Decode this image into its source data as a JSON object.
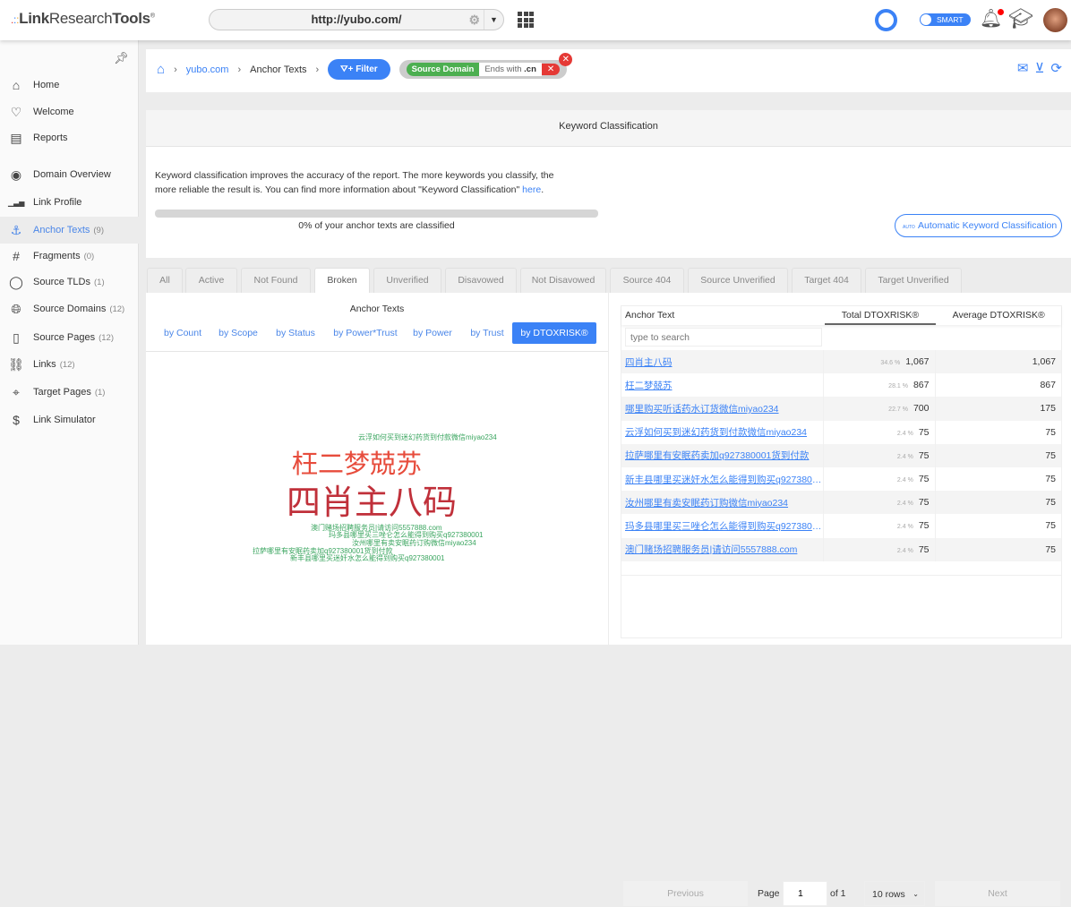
{
  "header": {
    "logo_prefix": "Link",
    "logo_mid": "Research",
    "logo_suffix": "Tools",
    "logo_mark": "®",
    "url": "http://yubo.com/",
    "smart_label": "SMART",
    "icons": [
      "gear-icon",
      "apps-grid-icon",
      "progress-ring-icon",
      "bell-icon",
      "graduation-cap-icon",
      "avatar"
    ]
  },
  "sidebar": {
    "items": [
      {
        "label": "Home",
        "count": "",
        "icon": "home-icon"
      },
      {
        "label": "Welcome",
        "count": "",
        "icon": "heart-icon"
      },
      {
        "label": "Reports",
        "count": "",
        "icon": "reports-icon"
      },
      {
        "label": "Domain Overview",
        "count": "",
        "icon": "eye-icon"
      },
      {
        "label": "Link Profile",
        "count": "",
        "icon": "bar-chart-icon"
      },
      {
        "label": "Anchor Texts",
        "count": "(9)",
        "icon": "anchor-icon",
        "active": true
      },
      {
        "label": "Fragments",
        "count": "(0)",
        "icon": "hash-icon"
      },
      {
        "label": "Source TLDs",
        "count": "(1)",
        "icon": "com-icon"
      },
      {
        "label": "Source Domains",
        "count": "(12)",
        "icon": "globe-icon"
      },
      {
        "label": "Source Pages",
        "count": "(12)",
        "icon": "url-file-icon"
      },
      {
        "label": "Links",
        "count": "(12)",
        "icon": "link-icon"
      },
      {
        "label": "Target Pages",
        "count": "(1)",
        "icon": "crosshair-icon"
      },
      {
        "label": "Link Simulator",
        "count": "",
        "icon": "dollar-icon"
      }
    ]
  },
  "breadcrumb": {
    "domain": "yubo.com",
    "page": "Anchor Texts",
    "filter_label": "Filter",
    "filter_chip": {
      "field": "Source Domain",
      "op": "Ends with",
      "value": ".cn"
    }
  },
  "classification": {
    "title": "Keyword Classification",
    "text": "Keyword classification improves the accuracy of the report. The more keywords you classify, the more reliable the result is. You can find more information about \"Keyword Classification\" ",
    "link": "here",
    "text_end": ".",
    "progress": 0,
    "progress_label": "0% of your anchor texts are classified",
    "auto_button": "Automatic Keyword Classification",
    "auto_badge": "AUTO"
  },
  "tabs": [
    "All",
    "Active",
    "Not Found",
    "Broken",
    "Unverified",
    "Disavowed",
    "Not Disavowed",
    "Source 404",
    "Source Unverified",
    "Target 404",
    "Target Unverified"
  ],
  "active_tab": "Broken",
  "cloud": {
    "title": "Anchor Texts",
    "sorts": [
      "by Count",
      "by Scope",
      "by Status",
      "by Power*Trust",
      "by Power",
      "by Trust",
      "by DTOXRISK®"
    ],
    "active_sort": "by DTOXRISK®",
    "words": [
      "云浮如何买到迷幻药货到付款微信miyao234",
      "枉二梦兢苏",
      "四肖主八码",
      "澳门赌场招聘服务员|请访问5557888.com",
      "玛多县哪里买三唑仑怎么能得到购买q927380001",
      "汝州哪里有卖安眠药订购微信miyao234",
      "拉萨哪里有安眠药卖加q927380001货到付款",
      "新丰县哪里买迷奸水怎么能得到购买q927380001"
    ],
    "colors": {
      "red": "#e74c3c",
      "darkred": "#c0303a",
      "green": "#3aa55f"
    }
  },
  "table": {
    "columns": [
      "Anchor Text",
      "Total DTOXRISK®",
      "Average DTOXRISK®"
    ],
    "search_placeholder": "type to search",
    "rows": [
      {
        "anchor": "四肖主八码",
        "pct": "34.6 %",
        "total": "1,067",
        "avg": "1,067"
      },
      {
        "anchor": "枉二梦兢苏",
        "pct": "28.1 %",
        "total": "867",
        "avg": "867"
      },
      {
        "anchor": "哪里购买听话药水订货微信miyao234",
        "pct": "22.7 %",
        "total": "700",
        "avg": "175"
      },
      {
        "anchor": "云浮如何买到迷幻药货到付款微信miyao234",
        "pct": "2.4 %",
        "total": "75",
        "avg": "75"
      },
      {
        "anchor": "拉萨哪里有安眠药卖加q927380001货到付款",
        "pct": "2.4 %",
        "total": "75",
        "avg": "75"
      },
      {
        "anchor": "新丰县哪里买迷奸水怎么能得到购买q9273800...",
        "pct": "2.4 %",
        "total": "75",
        "avg": "75"
      },
      {
        "anchor": "汝州哪里有卖安眠药订购微信miyao234",
        "pct": "2.4 %",
        "total": "75",
        "avg": "75"
      },
      {
        "anchor": "玛多县哪里买三唑仑怎么能得到购买q9273800...",
        "pct": "2.4 %",
        "total": "75",
        "avg": "75"
      },
      {
        "anchor": "澳门赌场招聘服务员|请访问5557888.com",
        "pct": "2.4 %",
        "total": "75",
        "avg": "75"
      }
    ]
  },
  "pagination": {
    "previous": "Previous",
    "page_label": "Page",
    "page": "1",
    "of_label": "of 1",
    "rows": "10 rows",
    "next": "Next"
  },
  "colors": {
    "accent": "#3b82f6",
    "green": "#4caf50",
    "red": "#e53935"
  }
}
